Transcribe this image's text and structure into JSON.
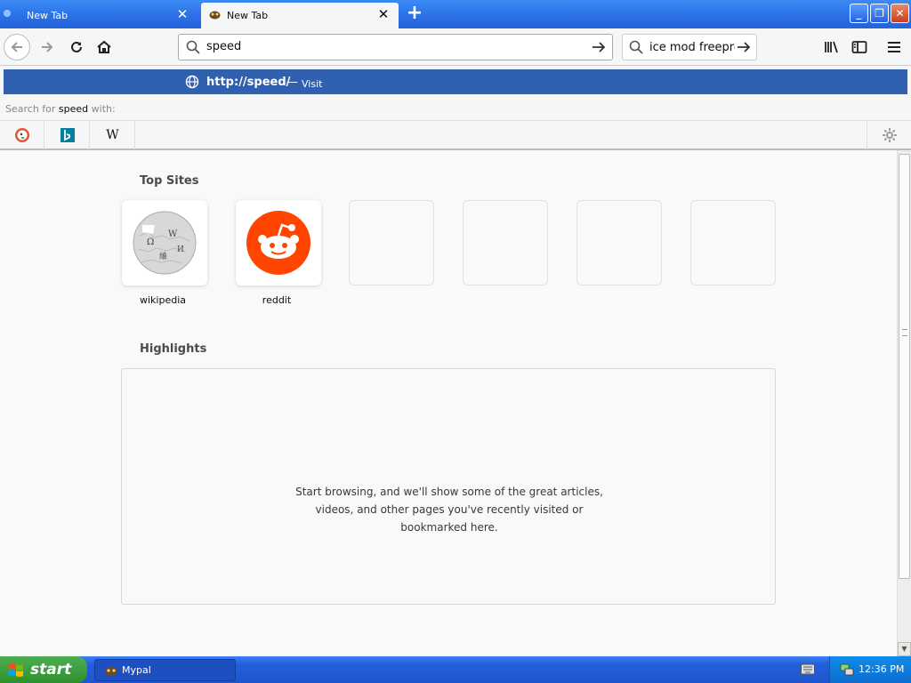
{
  "tabs": [
    {
      "label": "New Tab",
      "active": false
    },
    {
      "label": "New Tab",
      "active": true
    }
  ],
  "toolbar": {
    "url_value": "speed",
    "search_value": "ice mod freepro"
  },
  "url_popup": {
    "url": "http://speed/",
    "separator": "—",
    "action": "Visit",
    "search_with_prefix": "Search for",
    "search_with_term": "speed",
    "search_with_suffix": "with:",
    "engines": [
      {
        "name": "DuckDuckGo",
        "icon": "duckduckgo-icon"
      },
      {
        "name": "Bing",
        "icon": "bing-icon"
      },
      {
        "name": "Wikipedia",
        "icon": "wikipedia-icon"
      }
    ]
  },
  "top_sites": {
    "title": "Top Sites",
    "tiles": [
      {
        "label": "wikipedia",
        "icon": "wikipedia-globe-icon"
      },
      {
        "label": "reddit",
        "icon": "reddit-icon"
      },
      {
        "label": ""
      },
      {
        "label": ""
      },
      {
        "label": ""
      },
      {
        "label": ""
      }
    ]
  },
  "highlights": {
    "title": "Highlights",
    "empty_message": "Start browsing, and we'll show some of the great articles, videos, and other pages you've recently visited or bookmarked here."
  },
  "taskbar": {
    "start_label": "start",
    "window_label": "Mypal",
    "clock": "12:36 PM"
  },
  "colors": {
    "titlebar_blue": "#2a6ee6",
    "popup_highlight": "#3060b0",
    "reddit_orange": "#ff4500",
    "start_green": "#3a9d3a"
  }
}
